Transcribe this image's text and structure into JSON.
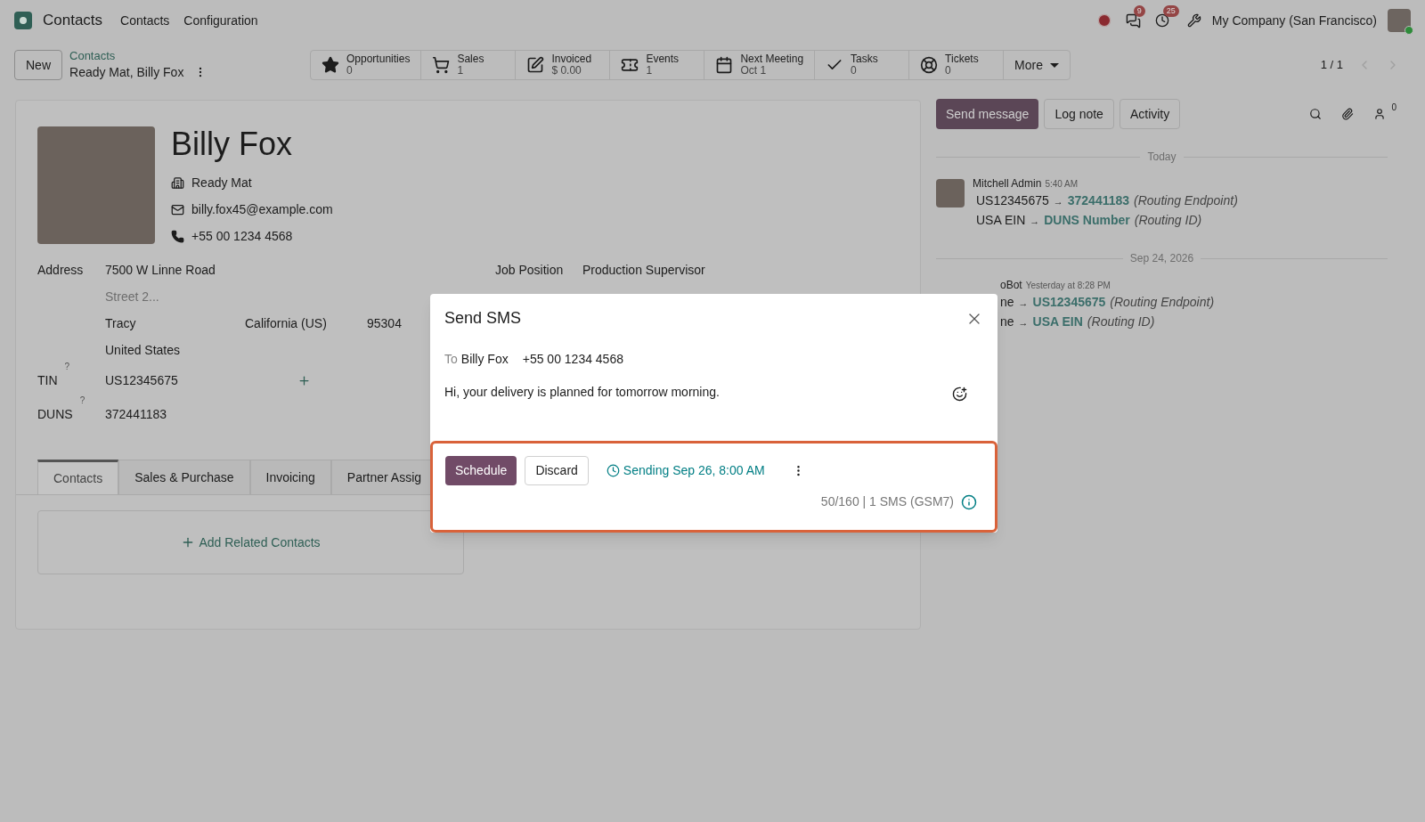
{
  "navbar": {
    "app_name": "Contacts",
    "menu": [
      "Contacts",
      "Configuration"
    ],
    "messages_count": "9",
    "activity_count": "25",
    "company": "My Company (San Francisco)"
  },
  "control_panel": {
    "new_button": "New",
    "breadcrumb": "Contacts",
    "record_title": "Ready Mat, Billy Fox",
    "smart_buttons": [
      {
        "kind": "opportunities",
        "label": "Opportunities",
        "value": "0"
      },
      {
        "kind": "sales",
        "label": "Sales",
        "value": "1"
      },
      {
        "kind": "invoiced",
        "label": "Invoiced",
        "value": "$ 0.00"
      },
      {
        "kind": "events",
        "label": "Events",
        "value": "1"
      },
      {
        "kind": "meeting",
        "label": "Next Meeting",
        "value": "Oct 1"
      },
      {
        "kind": "tasks",
        "label": "Tasks",
        "value": "0"
      },
      {
        "kind": "tickets",
        "label": "Tickets",
        "value": "0"
      }
    ],
    "more": "More",
    "pager": "1 / 1"
  },
  "form": {
    "name": "Billy Fox",
    "company": "Ready Mat",
    "email": "billy.fox45@example.com",
    "phone": "+55 00 1234 4568",
    "address_label": "Address",
    "street": "7500 W Linne Road",
    "street2_placeholder": "Street 2...",
    "city": "Tracy",
    "state": "California (US)",
    "zip": "95304",
    "country": "United States",
    "job_label": "Job Position",
    "job": "Production Supervisor",
    "fields": [
      {
        "label": "TIN",
        "help": "?",
        "value": "US12345675",
        "addable": true
      },
      {
        "label": "DUNS",
        "help": "?",
        "value": "372441183",
        "addable": false
      }
    ],
    "tabs": [
      {
        "label": "Contacts",
        "selected": true
      },
      {
        "label": "Sales & Purchase",
        "selected": false
      },
      {
        "label": "Invoicing",
        "selected": false
      },
      {
        "label": "Partner Assig",
        "selected": false
      }
    ],
    "add_related": "Add Related Contacts"
  },
  "chatter": {
    "buttons": [
      {
        "label": "Send message",
        "selected": true
      },
      {
        "label": "Log note",
        "selected": false
      },
      {
        "label": "Activity",
        "selected": false
      }
    ],
    "followers_count": "0",
    "messages": [
      {
        "separator": "Today",
        "author": "Mitchell Admin",
        "time": "5:40 AM",
        "covered": false,
        "lines": [
          {
            "old": "US12345675",
            "arrow": "→",
            "new": "372441183",
            "field": "(Routing Endpoint)"
          },
          {
            "old": "USA EIN",
            "arrow": "→",
            "new": "DUNS Number",
            "field": "(Routing ID)"
          }
        ]
      },
      {
        "separator": "Sep 24, 2026",
        "author": "oBot",
        "time": "Yesterday at 8:28 PM",
        "covered": true,
        "lines": [
          {
            "old": "ne",
            "arrow": "→",
            "new": "US12345675",
            "field": "(Routing Endpoint)"
          },
          {
            "old": "ne",
            "arrow": "→",
            "new": "USA EIN",
            "field": "(Routing ID)"
          }
        ]
      }
    ]
  },
  "dialog": {
    "title": "Send SMS",
    "to_label": "To",
    "recipient": "Billy Fox",
    "number": "+55 00 1234 4568",
    "message": "Hi, your delivery is planned for tomorrow morning.",
    "schedule": "Schedule",
    "discard": "Discard",
    "sending": "Sending Sep 26, 8:00 AM",
    "counter": "50/160 | 1 SMS (GSM7)"
  }
}
